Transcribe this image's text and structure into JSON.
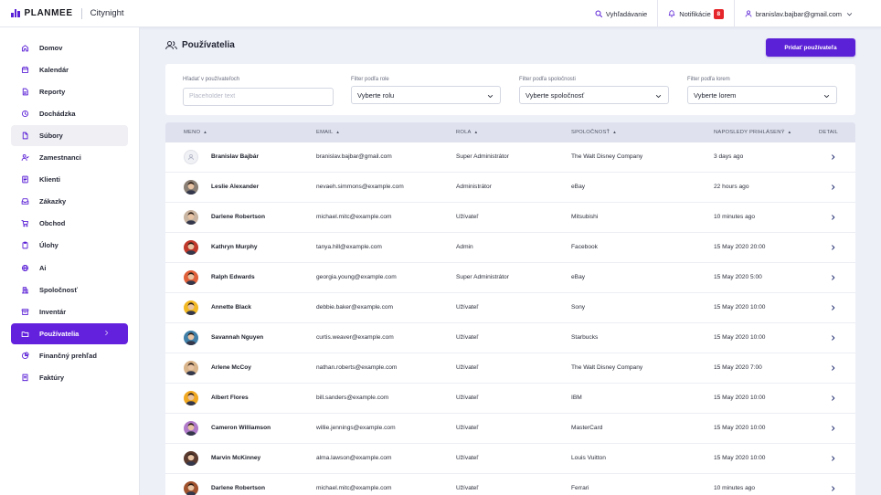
{
  "header": {
    "brand": "PLANMEE",
    "workspace": "Citynight",
    "search_label": "Vyhľadávanie",
    "notifications_label": "Notifikácie",
    "notifications_count": "8",
    "user_email": "branislav.bajbar@gmail.com",
    "accent_color": "#5b21d6"
  },
  "sidebar": {
    "items": [
      {
        "label": "Domov",
        "icon": "home-icon"
      },
      {
        "label": "Kalendár",
        "icon": "calendar-icon"
      },
      {
        "label": "Reporty",
        "icon": "document-icon"
      },
      {
        "label": "Dochádzka",
        "icon": "clock-icon"
      },
      {
        "label": "Súbory",
        "icon": "file-icon"
      },
      {
        "label": "Zamestnanci",
        "icon": "employees-icon"
      },
      {
        "label": "Klienti",
        "icon": "clients-icon"
      },
      {
        "label": "Zákazky",
        "icon": "inbox-icon"
      },
      {
        "label": "Obchod",
        "icon": "cart-icon"
      },
      {
        "label": "Úlohy",
        "icon": "clipboard-icon"
      },
      {
        "label": "Ai",
        "icon": "globe-icon"
      },
      {
        "label": "Spoločnosť",
        "icon": "building-icon"
      },
      {
        "label": "Inventár",
        "icon": "archive-icon"
      },
      {
        "label": "Používatelia",
        "icon": "folder-icon"
      },
      {
        "label": "Finančný prehľad",
        "icon": "pie-chart-icon"
      },
      {
        "label": "Faktúry",
        "icon": "invoice-icon"
      }
    ],
    "hover_index": 4,
    "active_index": 13,
    "active_color": "#6320dd"
  },
  "page": {
    "title": "Používatelia",
    "add_button": "Pridať používateľa"
  },
  "filters": {
    "search_label": "Hľadať v používateľoch",
    "search_placeholder": "Placeholder text",
    "search_value": "",
    "role_label": "Filter podľa role",
    "role_value": "Vyberte rolu",
    "company_label": "Filter podľa spoločnosti",
    "company_value": "Vyberte spoločnosť",
    "lorem_label": "Filter podľa lorem",
    "lorem_value": "Vyberte lorem"
  },
  "table": {
    "columns": {
      "name": "MENO",
      "email": "EMAIL",
      "role": "ROLA",
      "company": "SPOLOČNOSŤ",
      "last_login": "NAPOSLEDY PRIHLÁSENÝ",
      "detail": "DETAIL"
    },
    "rows": [
      {
        "name": "Branislav Bajbár",
        "email": "branislav.bajbar@gmail.com",
        "role": "Super Administrátor",
        "company": "The Walt Disney Company",
        "last_login": "3 days ago",
        "avatar": "placeholder",
        "avatar_color": "#e9ebf1"
      },
      {
        "name": "Leslie Alexander",
        "email": "nevaeh.simmons@example.com",
        "role": "Administrátor",
        "company": "eBay",
        "last_login": "22 hours ago",
        "avatar": "photo",
        "avatar_color": "#8a7f74"
      },
      {
        "name": "Darlene Robertson",
        "email": "michael.mitc@example.com",
        "role": "Užívateľ",
        "company": "Mitsubishi",
        "last_login": "10 minutes ago",
        "avatar": "photo",
        "avatar_color": "#c8b4a0"
      },
      {
        "name": "Kathryn Murphy",
        "email": "tanya.hill@example.com",
        "role": "Admin",
        "company": "Facebook",
        "last_login": "15 May 2020 20:00",
        "avatar": "photo",
        "avatar_color": "#c0392b"
      },
      {
        "name": "Ralph Edwards",
        "email": "georgia.young@example.com",
        "role": "Super Administrátor",
        "company": "eBay",
        "last_login": "15 May 2020 5:00",
        "avatar": "photo",
        "avatar_color": "#e0603a"
      },
      {
        "name": "Annette Black",
        "email": "debbie.baker@example.com",
        "role": "Užívateľ",
        "company": "Sony",
        "last_login": "15 May 2020 10:00",
        "avatar": "photo",
        "avatar_color": "#f2b824"
      },
      {
        "name": "Savannah Nguyen",
        "email": "curtis.weaver@example.com",
        "role": "Užívateľ",
        "company": "Starbucks",
        "last_login": "15 May 2020 10:00",
        "avatar": "photo",
        "avatar_color": "#3f7fa8"
      },
      {
        "name": "Arlene McCoy",
        "email": "nathan.roberts@example.com",
        "role": "Užívateľ",
        "company": "The Walt Disney Company",
        "last_login": "15 May 2020 7:00",
        "avatar": "photo",
        "avatar_color": "#d9b48a"
      },
      {
        "name": "Albert Flores",
        "email": "bill.sanders@example.com",
        "role": "Užívateľ",
        "company": "IBM",
        "last_login": "15 May 2020 10:00",
        "avatar": "photo",
        "avatar_color": "#f0a822"
      },
      {
        "name": "Cameron Williamson",
        "email": "willie.jennings@example.com",
        "role": "Užívateľ",
        "company": "MasterCard",
        "last_login": "15 May 2020 10:00",
        "avatar": "photo",
        "avatar_color": "#b07ac9"
      },
      {
        "name": "Marvin McKinney",
        "email": "alma.lawson@example.com",
        "role": "Užívateľ",
        "company": "Louis Vuitton",
        "last_login": "15 May 2020 10:00",
        "avatar": "photo",
        "avatar_color": "#5a3a2e"
      },
      {
        "name": "Darlene Robertson",
        "email": "michael.mitc@example.com",
        "role": "Užívateľ",
        "company": "Ferrari",
        "last_login": "10 minutes ago",
        "avatar": "photo",
        "avatar_color": "#a0522d"
      }
    ]
  }
}
